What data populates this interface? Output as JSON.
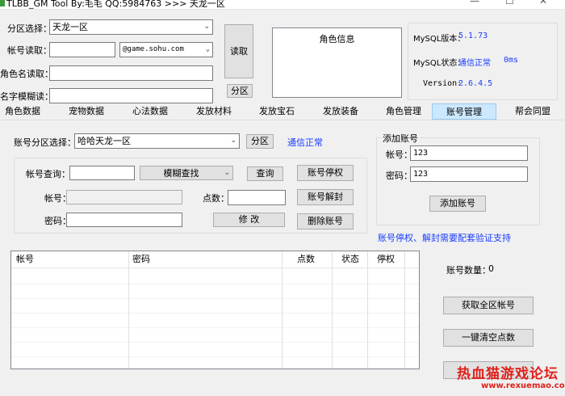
{
  "window": {
    "title": "TLBB_GM Tool By:毛毛 QQ:5984763 >>> 天龙一区",
    "icon": "app-icon"
  },
  "top": {
    "zone_label": "分区选择：",
    "zone_value": "天龙一区",
    "account_read_label": "帐号读取：",
    "account_read_value": "",
    "domain_value": "@game.sohu.com",
    "rolename_read_label": "角色名读取：",
    "rolename_read_value": "",
    "fuzzy_read_label": "名字模糊读：",
    "fuzzy_read_value": "",
    "read_button": "读取",
    "zone_button": "分区",
    "role_info_title": "角色信息"
  },
  "mysql": {
    "version_label": "MySQL版本：",
    "version_value": "5.1.73",
    "status_label": "MySQL状态：",
    "status_value": "通信正常",
    "latency": "0ms",
    "app_version_label": "Version:",
    "app_version_value": "2.6.4.5"
  },
  "tabs": [
    {
      "label": "角色数据"
    },
    {
      "label": "宠物数据"
    },
    {
      "label": "心法数据"
    },
    {
      "label": "发放材料"
    },
    {
      "label": "发放宝石"
    },
    {
      "label": "发放装备"
    },
    {
      "label": "角色管理"
    },
    {
      "label": "账号管理"
    },
    {
      "label": "帮会同盟"
    }
  ],
  "account": {
    "zone_select_label": "账号分区选择：",
    "zone_select_value": "哈哈天龙一区",
    "zone_button": "分区",
    "comm_status": "通信正常",
    "query_label": "帐号查询：",
    "query_value": "",
    "mode_value": "模糊查找",
    "query_button": "查询",
    "ban_button": "账号停权",
    "account_label": "帐号：",
    "account_value": "",
    "points_label": "点数：",
    "points_value": "",
    "unban_button": "账号解封",
    "password_label": "密码：",
    "password_value": "",
    "modify_button": "修  改",
    "delete_button": "删除账号"
  },
  "add_account": {
    "group_title": "添加账号",
    "account_label": "帐号：",
    "account_value": "123",
    "password_label": "密码：",
    "password_value": "123",
    "add_button": "添加账号"
  },
  "notice": "账号停权、解封需要配套验证支持",
  "table": {
    "columns": [
      "帐号",
      "密码",
      "点数",
      "状态",
      "停权"
    ],
    "rows": []
  },
  "side": {
    "count_label": "账号数量：",
    "count_value": "0",
    "fetch_all_button": "获取全区帐号",
    "clear_points_button": "一键清空点数",
    "watermark_title": "热血猫游戏论坛",
    "watermark_url": "www.rexuemao.com"
  },
  "colors": {
    "accent_blue": "#1a3cff",
    "tab_active_bg": "#cce8ff",
    "watermark_red": "#e0201a"
  }
}
